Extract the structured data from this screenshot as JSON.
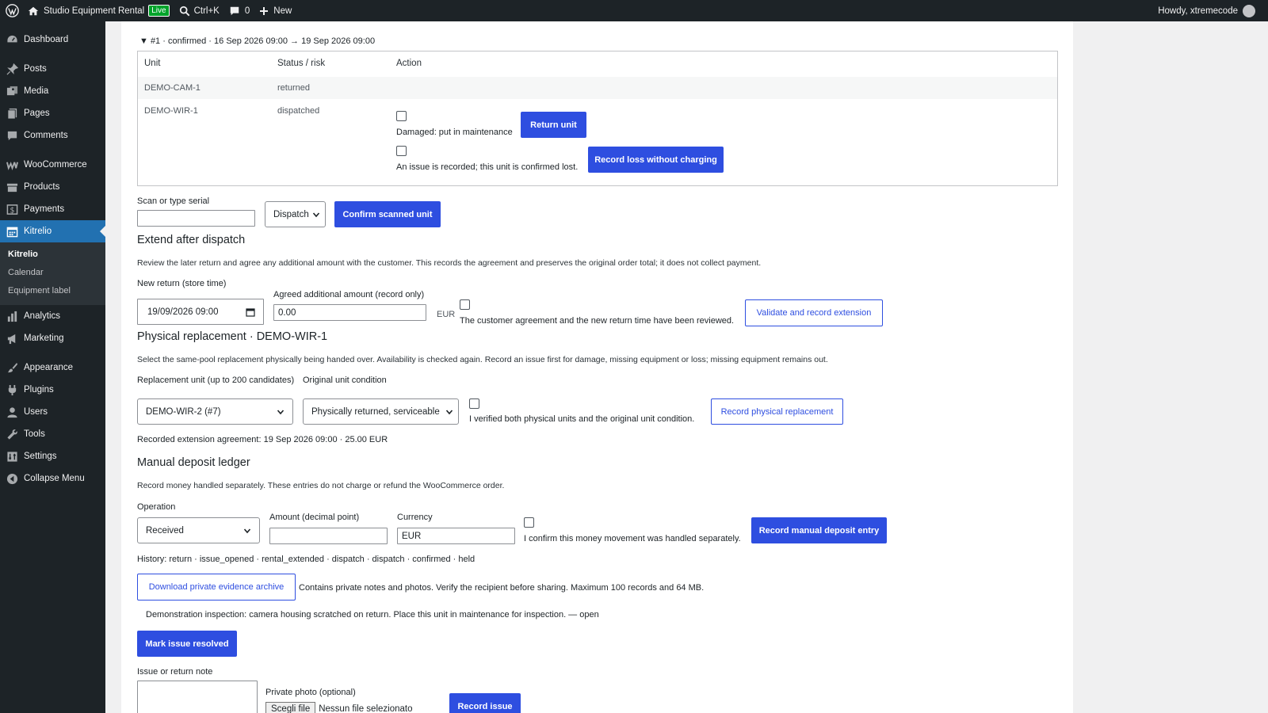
{
  "admin_bar": {
    "site_name": "Studio Equipment Rental",
    "live_badge": "Live",
    "search_shortcut": "Ctrl+K",
    "comments_count": "0",
    "new_label": "New",
    "greeting": "Howdy, xtremecode"
  },
  "sidebar": {
    "items": [
      {
        "label": "Dashboard",
        "icon": "dashboard-icon"
      },
      {
        "label": "Posts",
        "icon": "pin-icon"
      },
      {
        "label": "Media",
        "icon": "media-icon"
      },
      {
        "label": "Pages",
        "icon": "pages-icon"
      },
      {
        "label": "Comments",
        "icon": "comments-icon"
      },
      {
        "label": "WooCommerce",
        "icon": "woo-icon"
      },
      {
        "label": "Products",
        "icon": "products-icon"
      },
      {
        "label": "Payments",
        "icon": "payments-icon"
      },
      {
        "label": "Kitrelio",
        "icon": "calendar-icon"
      },
      {
        "label": "Analytics",
        "icon": "analytics-icon"
      },
      {
        "label": "Marketing",
        "icon": "megaphone-icon"
      },
      {
        "label": "Appearance",
        "icon": "brush-icon"
      },
      {
        "label": "Plugins",
        "icon": "plugin-icon"
      },
      {
        "label": "Users",
        "icon": "user-icon"
      },
      {
        "label": "Tools",
        "icon": "wrench-icon"
      },
      {
        "label": "Settings",
        "icon": "settings-icon"
      },
      {
        "label": "Collapse Menu",
        "icon": "collapse-icon"
      }
    ],
    "submenu": [
      "Kitrelio",
      "Calendar",
      "Equipment label"
    ]
  },
  "booking": {
    "summary": "▼ #1 · confirmed · 16 Sep 2026 09:00 → 19 Sep 2026 09:00",
    "columns": [
      "Unit",
      "Status / risk",
      "Action"
    ],
    "rows": [
      {
        "unit": "DEMO-CAM-1",
        "status": "returned"
      },
      {
        "unit": "DEMO-WIR-1",
        "status": "dispatched"
      }
    ],
    "damaged_label": "Damaged: put in maintenance",
    "return_button": "Return unit",
    "issue_label": "An issue is recorded; this unit is confirmed lost.",
    "loss_button": "Record loss without charging"
  },
  "scan": {
    "label": "Scan or type serial",
    "value": "",
    "mode": "Dispatch",
    "confirm_button": "Confirm scanned unit"
  },
  "extend": {
    "title": "Extend after dispatch",
    "description": "Review the later return and agree any additional amount with the customer. This records the agreement and preserves the original order total; it does not collect payment.",
    "return_label": "New return (store time)",
    "return_value": "19/09/2026 09:00",
    "amount_label": "Agreed additional amount (record only)",
    "amount_value": "0.00",
    "currency": "EUR",
    "confirm_label": "The customer agreement and the new return time have been reviewed.",
    "button": "Validate and record extension"
  },
  "replacement": {
    "title": "Physical replacement · DEMO-WIR-1",
    "description": "Select the same-pool replacement physically being handed over. Availability is checked again. Record an issue first for damage, missing equipment or loss; missing equipment remains out.",
    "unit_label": "Replacement unit (up to 200 candidates)",
    "unit_value": "DEMO-WIR-2 (#7)",
    "condition_label": "Original unit condition",
    "condition_value": "Physically returned, serviceable",
    "verify_label": "I verified both physical units and the original unit condition.",
    "button": "Record physical replacement",
    "recorded_note": "Recorded extension agreement: 19 Sep 2026 09:00 · 25.00 EUR"
  },
  "deposit": {
    "title": "Manual deposit ledger",
    "description": "Record money handled separately. These entries do not charge or refund the WooCommerce order.",
    "operation_label": "Operation",
    "operation_value": "Received",
    "amount_label": "Amount (decimal point)",
    "amount_value": "",
    "currency_label": "Currency",
    "currency_value": "EUR",
    "confirm_label": "I confirm this money movement was handled separately.",
    "button": "Record manual deposit entry",
    "history": "History: return · issue_opened · rental_extended · dispatch · dispatch · confirmed · held"
  },
  "evidence": {
    "button": "Download private evidence archive",
    "note": "Contains private notes and photos. Verify the recipient before sharing. Maximum 100 records and 64 MB.",
    "inspection": "Demonstration inspection: camera housing scratched on return. Place this unit in maintenance for inspection. — open",
    "resolve_button": "Mark issue resolved"
  },
  "issue": {
    "note_label": "Issue or return note",
    "photo_label": "Private photo (optional)",
    "file_button": "Scegli file",
    "file_status": "Nessun file selezionato",
    "button": "Record issue"
  },
  "colors": {
    "primary": "#2e4ee0",
    "admin_bar": "#1d2327",
    "menu_active": "#2271b1",
    "live": "#00a32a"
  }
}
